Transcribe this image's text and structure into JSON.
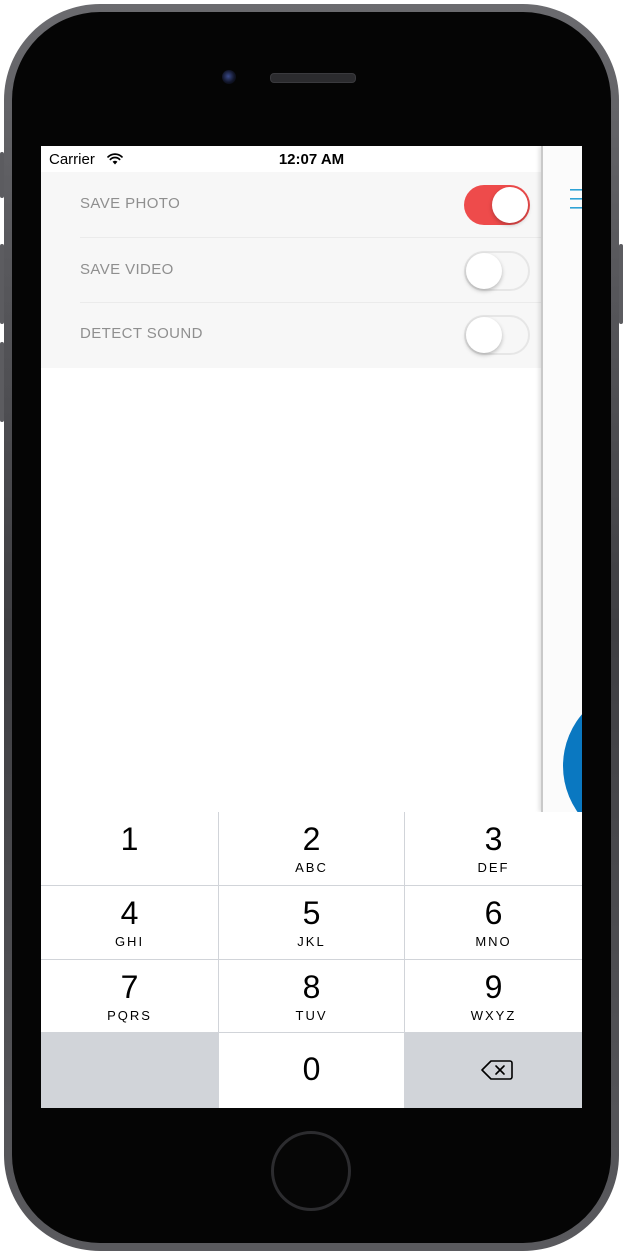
{
  "status_bar": {
    "carrier": "Carrier",
    "time": "12:07 AM"
  },
  "settings": {
    "items": [
      {
        "label": "SAVE PHOTO",
        "enabled": true
      },
      {
        "label": "SAVE VIDEO",
        "enabled": false
      },
      {
        "label": "DETECT SOUND",
        "enabled": false
      }
    ]
  },
  "keypad": {
    "keys": [
      {
        "digit": "1",
        "letters": ""
      },
      {
        "digit": "2",
        "letters": "ABC"
      },
      {
        "digit": "3",
        "letters": "DEF"
      },
      {
        "digit": "4",
        "letters": "GHI"
      },
      {
        "digit": "5",
        "letters": "JKL"
      },
      {
        "digit": "6",
        "letters": "MNO"
      },
      {
        "digit": "7",
        "letters": "PQRS"
      },
      {
        "digit": "8",
        "letters": "TUV"
      },
      {
        "digit": "9",
        "letters": "WXYZ"
      },
      {
        "digit": "0",
        "letters": ""
      }
    ],
    "delete_icon": "backspace-icon"
  },
  "colors": {
    "toggle_on": "#ee4b4b",
    "accent_blue": "#0a78c1",
    "menu_icon": "#2ea3d6",
    "label_gray": "#8f8f8f",
    "keypad_bg": "#d1d4d9"
  },
  "icons": {
    "wifi": "wifi-icon",
    "battery": "battery-icon",
    "menu": "hamburger-menu-icon"
  }
}
